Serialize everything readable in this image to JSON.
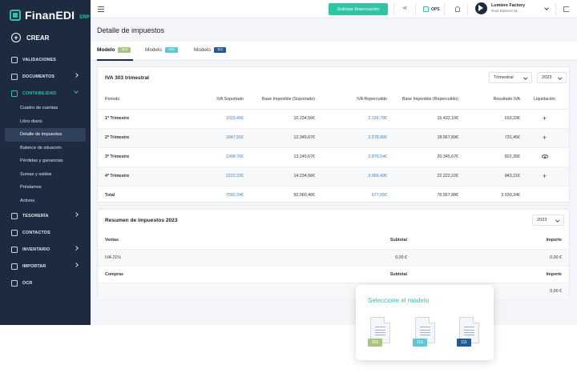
{
  "colors": {
    "sidebar_bg": "#1d2a3f",
    "accent": "#2ec4a5",
    "link": "#3a7ed6",
    "badge_303": "#a9c47f",
    "badge_115": "#5fc6d6",
    "badge_111": "#1f5d96"
  },
  "brand": {
    "name": "FinanEDI",
    "sub": "ERP"
  },
  "sidebar": {
    "create_label": "CREAR",
    "items": [
      {
        "label": "VALIDACIONES",
        "icon": "checklist-icon"
      },
      {
        "label": "DOCUMENTOS",
        "icon": "documents-icon"
      },
      {
        "label": "CONTABILIDAD",
        "icon": "accounting-icon"
      },
      {
        "label": "TESORERÍA",
        "icon": "treasury-icon"
      },
      {
        "label": "CONTACTOS",
        "icon": "contacts-icon"
      },
      {
        "label": "INVENTARIO",
        "icon": "inventory-icon"
      },
      {
        "label": "IMPORTAR",
        "icon": "import-icon"
      },
      {
        "label": "OCR",
        "icon": "ocr-icon"
      }
    ],
    "sub_items": [
      "Cuadro de cuentas",
      "Libro diario",
      "Detalle de impuestos",
      "Balance de situación",
      "Pérdidas y ganancias",
      "Sumas y saldos",
      "Préstamos",
      "Activos"
    ]
  },
  "topbar": {
    "primary_button": "Solicitar financiación",
    "ops_label": "OPS",
    "user_name": "Lumiere Factory",
    "user_sub": "Raúl Estévez M."
  },
  "page": {
    "title": "Detalle de impuestos"
  },
  "tabs": [
    {
      "label": "Modelo",
      "badge": "303"
    },
    {
      "label": "Modelo",
      "badge": "115"
    },
    {
      "label": "Modelo",
      "badge": "111"
    }
  ],
  "iva": {
    "title": "IVA 303 trimestral",
    "period_select": "Trimestral",
    "year_select": "2023",
    "headers": [
      "Periodo",
      "IVA Soportado",
      "Base Imponible (Soportado)",
      "IVA Repercutido",
      "Base Imponible (Repercutido)",
      "Resultado IVA",
      "Liquidación"
    ],
    "rows": [
      {
        "periodo": "1º Trimestre",
        "iva_sop": "1523.45€",
        "base_sop": "10.234,56€",
        "iva_rep": "2.156,78€",
        "base_rep": "15.432,10€",
        "resultado": "633,33€",
        "action": "plus"
      },
      {
        "periodo": "2º Trimestre",
        "iva_sop": "1847.91€",
        "base_sop": "12.345,67€",
        "iva_rep": "2.578,90€",
        "base_rep": "18.567,89€",
        "resultado": "731,45€",
        "action": "plus"
      },
      {
        "periodo": "3º Trimestre",
        "iva_sop": "1998.76€",
        "base_sop": "13.245,67€",
        "iva_rep": "2.876,54€",
        "base_rep": "20.345,67€",
        "resultado": "822,35€",
        "action": "eye"
      },
      {
        "periodo": "4º Trimestre",
        "iva_sop": "2222.22€",
        "base_sop": "14.234,56€",
        "iva_rep": "3.065,43€",
        "base_rep": "22.222,22€",
        "resultado": "843,21€",
        "action": "plus"
      }
    ],
    "total": {
      "label": "Total",
      "iva_sop": "7592.34€",
      "base_sop": "50.060,46€",
      "iva_rep": "677,65€",
      "base_rep": "76.567,88€",
      "resultado": "3.030,34€"
    }
  },
  "resumen": {
    "title": "Resumen de impuestos 2023",
    "year_select": "2023",
    "ventas": {
      "label": "Ventas",
      "subtotal": "Subtotal",
      "importe": "Importe"
    },
    "ventas_row": {
      "label": "IVA 21%",
      "subtotal": "0,00 €",
      "importe": "0,00 €"
    },
    "compras": {
      "label": "Compras",
      "subtotal": "Subtotal",
      "importe": "Importe"
    },
    "compras_row": {
      "label": "",
      "subtotal": "",
      "importe": "0,00 €"
    }
  },
  "popup": {
    "title": "Seleccione el modelo",
    "models": [
      "303",
      "115",
      "111"
    ]
  }
}
